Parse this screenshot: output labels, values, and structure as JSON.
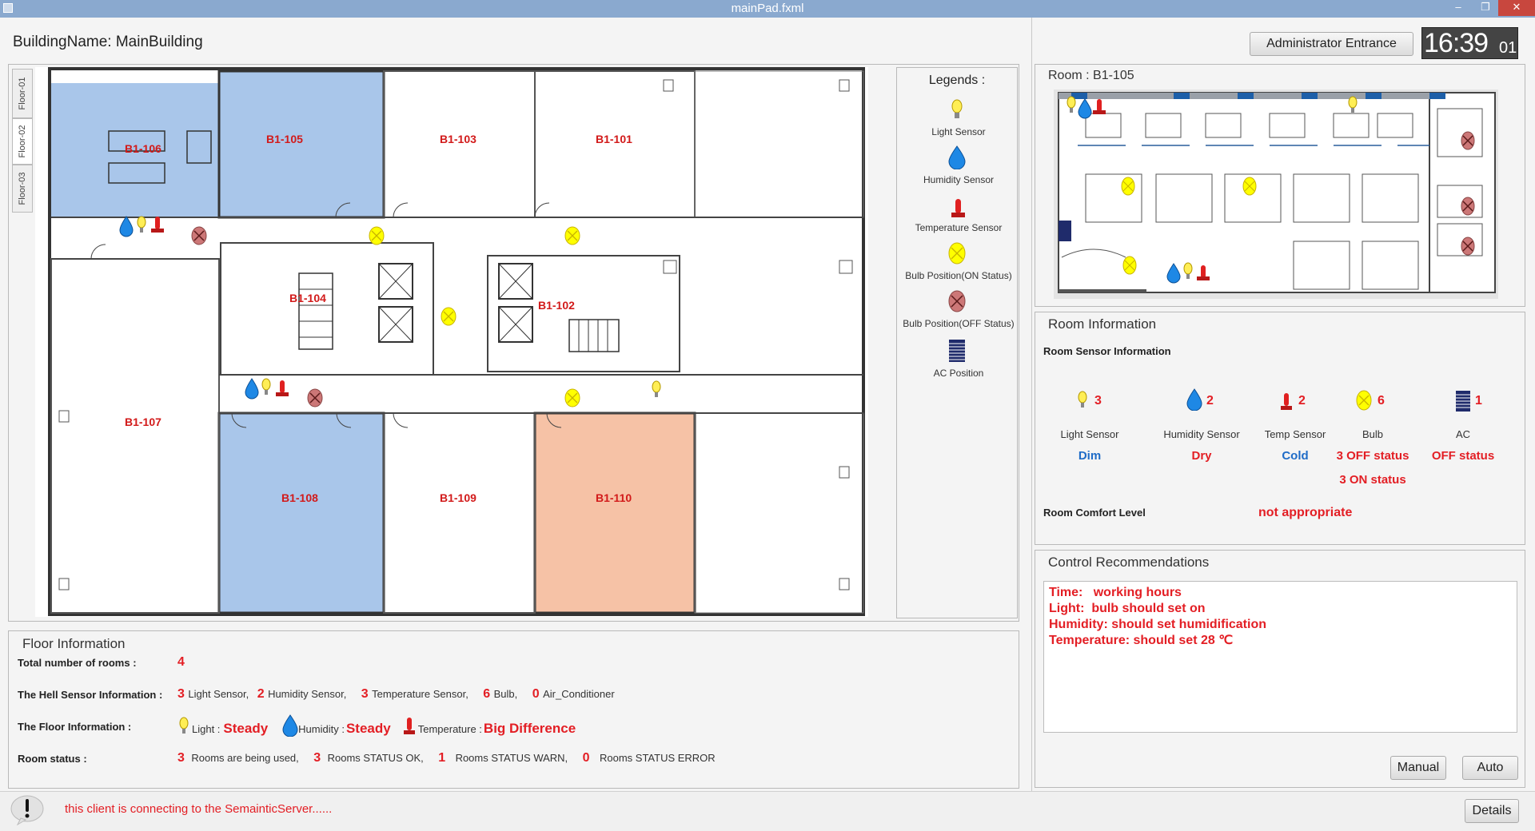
{
  "window": {
    "title": "mainPad.fxml",
    "min": "‒",
    "restore": "❐",
    "close": "✕"
  },
  "building": {
    "label": "BuildingName: MainBuilding"
  },
  "floors": [
    "Floor-01",
    "Floor-02",
    "Floor-03"
  ],
  "floorplan": {
    "rooms": [
      "B1-106",
      "B1-105",
      "B1-103",
      "B1-101",
      "B1-104",
      "B1-102",
      "B1-107",
      "B1-108",
      "B1-109",
      "B1-110"
    ],
    "colors": {
      "blue": "#a9c6ea",
      "orange": "#f6c2a6"
    }
  },
  "legends": {
    "title": "Legends :",
    "items": [
      "Light Sensor",
      "Humidity Sensor",
      "Temperature Sensor",
      "Bulb Position(ON Status)",
      "Bulb Position(OFF Status)",
      "AC Position"
    ]
  },
  "header": {
    "admin_button": "Administrator Entrance",
    "clock_main": "16:39",
    "clock_sec": "01"
  },
  "room_view": {
    "title": "Room : B1-105"
  },
  "room_info": {
    "title": "Room Information",
    "sensor_title": "Room Sensor Information",
    "sensors": [
      {
        "count": "3",
        "label": "Light Sensor",
        "status": "Dim"
      },
      {
        "count": "2",
        "label": "Humidity Sensor",
        "status": "Dry"
      },
      {
        "count": "2",
        "label": "Temp Sensor",
        "status": "Cold"
      },
      {
        "count": "6",
        "label": "Bulb",
        "status": "3 OFF status",
        "status2": "3 ON status"
      },
      {
        "count": "1",
        "label": "AC",
        "status": "OFF status"
      }
    ],
    "comfort_label": "Room Comfort Level",
    "comfort_value": "not appropriate"
  },
  "control": {
    "title": "Control Recommendations",
    "lines": [
      "Time:   working hours",
      "Light:  bulb should set on",
      "Humidity: should set humidification",
      "Temperature: should set 28 ℃"
    ],
    "manual": "Manual",
    "auto": "Auto"
  },
  "floor_info": {
    "title": "Floor Information",
    "total_label": "Total number of rooms :",
    "total_value": "4",
    "hell_label": "The Hell Sensor Information :",
    "hell": [
      {
        "n": "3",
        "t": "Light Sensor,"
      },
      {
        "n": "2",
        "t": "Humidity Sensor,"
      },
      {
        "n": "3",
        "t": "Temperature Sensor,"
      },
      {
        "n": "6",
        "t": "Bulb,"
      },
      {
        "n": "0",
        "t": "Air_Conditioner"
      }
    ],
    "floor_label": "The Floor Information :",
    "light_label": "Light :",
    "light_value": "Steady",
    "humidity_label": "Humidity :",
    "humidity_value": "Steady",
    "temp_label": "Temperature :",
    "temp_value": "Big Difference",
    "status_label": "Room status :",
    "status": [
      {
        "n": "3",
        "t": "Rooms are being used,"
      },
      {
        "n": "3",
        "t": "Rooms STATUS OK,"
      },
      {
        "n": "1",
        "t": "Rooms STATUS WARN,"
      },
      {
        "n": "0",
        "t": "Rooms STATUS ERROR"
      }
    ]
  },
  "statusbar": {
    "message": "this client is connecting to the SemainticServer......",
    "details": "Details"
  }
}
